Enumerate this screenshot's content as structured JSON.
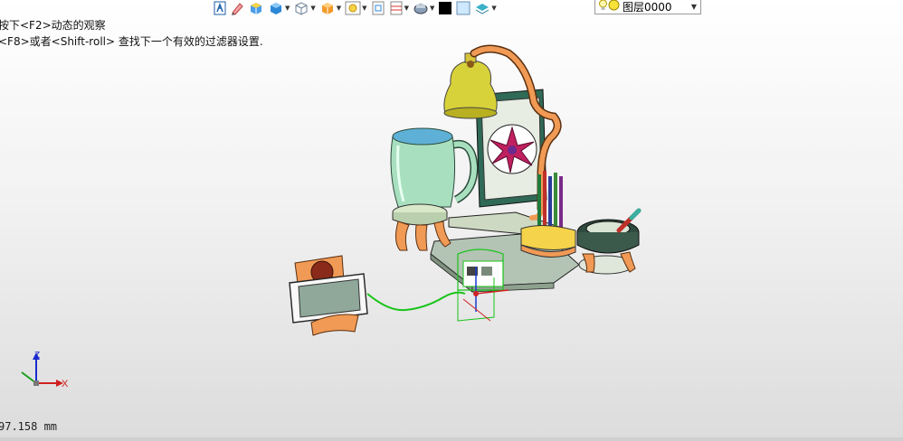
{
  "toolbar": {
    "tools": [
      {
        "icon": "walk-view-icon"
      },
      {
        "icon": "pencil-icon"
      },
      {
        "icon": "shaded-cube-icon"
      },
      {
        "icon": "blue-cube-icon",
        "has_dropdown": true
      },
      {
        "icon": "wireframe-cube-icon",
        "has_dropdown": true
      },
      {
        "icon": "orange-cube-icon",
        "has_dropdown": true
      },
      {
        "icon": "zoom-view-icon",
        "has_dropdown": true
      },
      {
        "icon": "fit-view-icon"
      },
      {
        "icon": "section-view-icon",
        "has_dropdown": true
      },
      {
        "icon": "render-mode-icon",
        "has_dropdown": true
      },
      {
        "icon": "black-color-swatch-icon"
      },
      {
        "icon": "light-color-swatch-icon"
      },
      {
        "icon": "layer-stack-icon",
        "has_dropdown": true
      }
    ],
    "layer_select": {
      "value": "图层0000",
      "icon": "light-bulb-icon"
    }
  },
  "hints": {
    "line1": "按下<F2>动态的观察",
    "line2": "<F8>或者<Shift-roll> 查找下一个有效的过滤器设置."
  },
  "status": {
    "coordinate": "97.158 mm"
  },
  "axis_labels": {
    "z": "Z",
    "x": "X"
  },
  "colors": {
    "mug": "#a8e0bf",
    "bell": "#d8d23a",
    "pipe": "#f09a55",
    "base": "#b3c3b4",
    "frame": "#2f6a56",
    "selection": "#19c419"
  }
}
